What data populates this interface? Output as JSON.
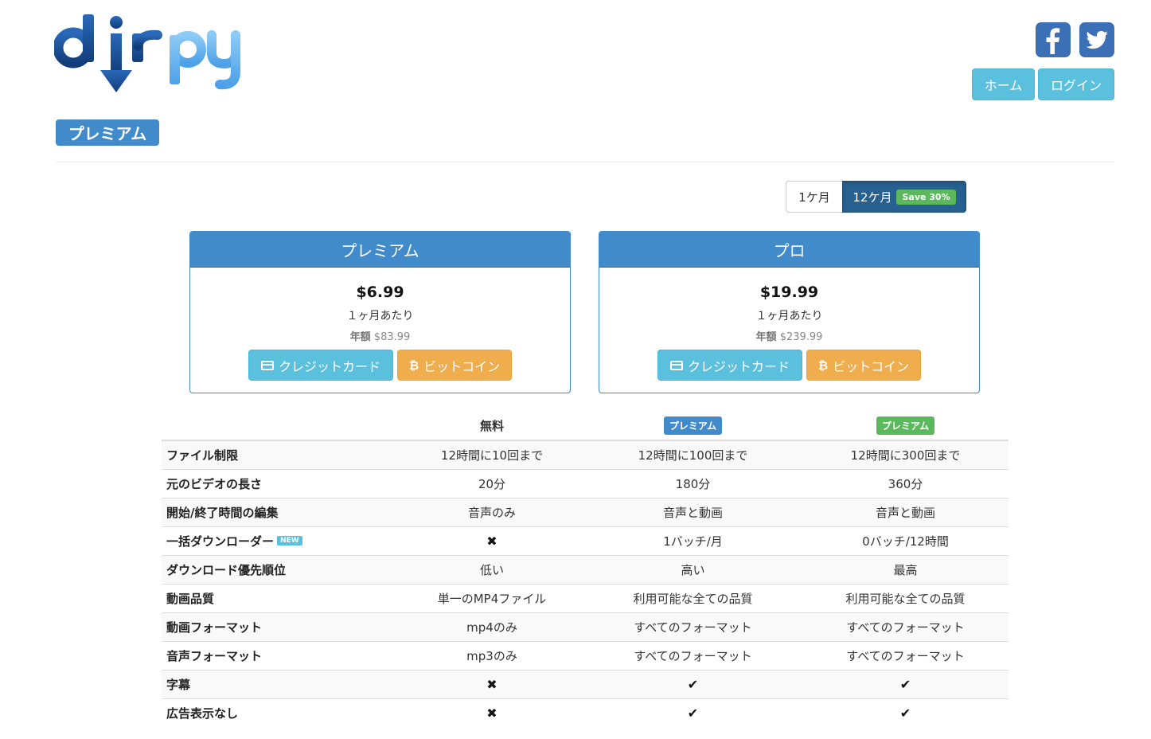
{
  "header": {
    "logo": {
      "text": "dirpy",
      "colors": {
        "dark": "#1a4f93",
        "light": "#6ab4f0"
      }
    },
    "social": [
      {
        "name": "facebook-icon",
        "glyph": "f"
      },
      {
        "name": "twitter-icon",
        "glyph": "twitter-bird"
      }
    ],
    "nav": {
      "home_label": "ホーム",
      "login_label": "ログイン"
    }
  },
  "page_label": "プレミアム",
  "period_toggle": {
    "monthly_label": "1ケ月",
    "yearly_label": "12ケ月",
    "save_badge": "Save 30%",
    "active": "yearly"
  },
  "plans": [
    {
      "title": "プレミアム",
      "price": "$6.99",
      "per": "１ヶ月あたり",
      "annual_label": "年額",
      "annual_value": "$83.99",
      "cc_label": "クレジットカード",
      "btc_label": "ビットコイン"
    },
    {
      "title": "プロ",
      "price": "$19.99",
      "per": "１ヶ月あたり",
      "annual_label": "年額",
      "annual_value": "$239.99",
      "cc_label": "クレジットカード",
      "btc_label": "ビットコイン"
    }
  ],
  "comparison": {
    "headers": {
      "free": "無料",
      "premium": "プレミアム",
      "pro": "プレミアム"
    },
    "new_badge": "NEW",
    "rows": [
      {
        "feature": "ファイル制限",
        "free": "12時間に10回まで",
        "premium": "12時間に100回まで",
        "pro": "12時間に300回まで"
      },
      {
        "feature": "元のビデオの長さ",
        "free": "20分",
        "premium": "180分",
        "pro": "360分"
      },
      {
        "feature": "開始/終了時間の編集",
        "free": "音声のみ",
        "premium": "音声と動画",
        "pro": "音声と動画"
      },
      {
        "feature": "一括ダウンローダー",
        "free": "✖",
        "premium": "1バッチ/月",
        "pro": "0バッチ/12時間"
      },
      {
        "feature": "ダウンロード優先順位",
        "free": "低い",
        "premium": "高い",
        "pro": "最高"
      },
      {
        "feature": "動画品質",
        "free": "単一のMP4ファイル",
        "premium": "利用可能な全ての品質",
        "pro": "利用可能な全ての品質"
      },
      {
        "feature": "動画フォーマット",
        "free": "mp4のみ",
        "premium": "すべてのフォーマット",
        "pro": "すべてのフォーマット"
      },
      {
        "feature": "音声フォーマット",
        "free": "mp3のみ",
        "premium": "すべてのフォーマット",
        "pro": "すべてのフォーマット"
      },
      {
        "feature": "字幕",
        "free": "✖",
        "premium": "✔",
        "pro": "✔"
      },
      {
        "feature": "広告表示なし",
        "free": "✖",
        "premium": "✔",
        "pro": "✔"
      }
    ]
  }
}
